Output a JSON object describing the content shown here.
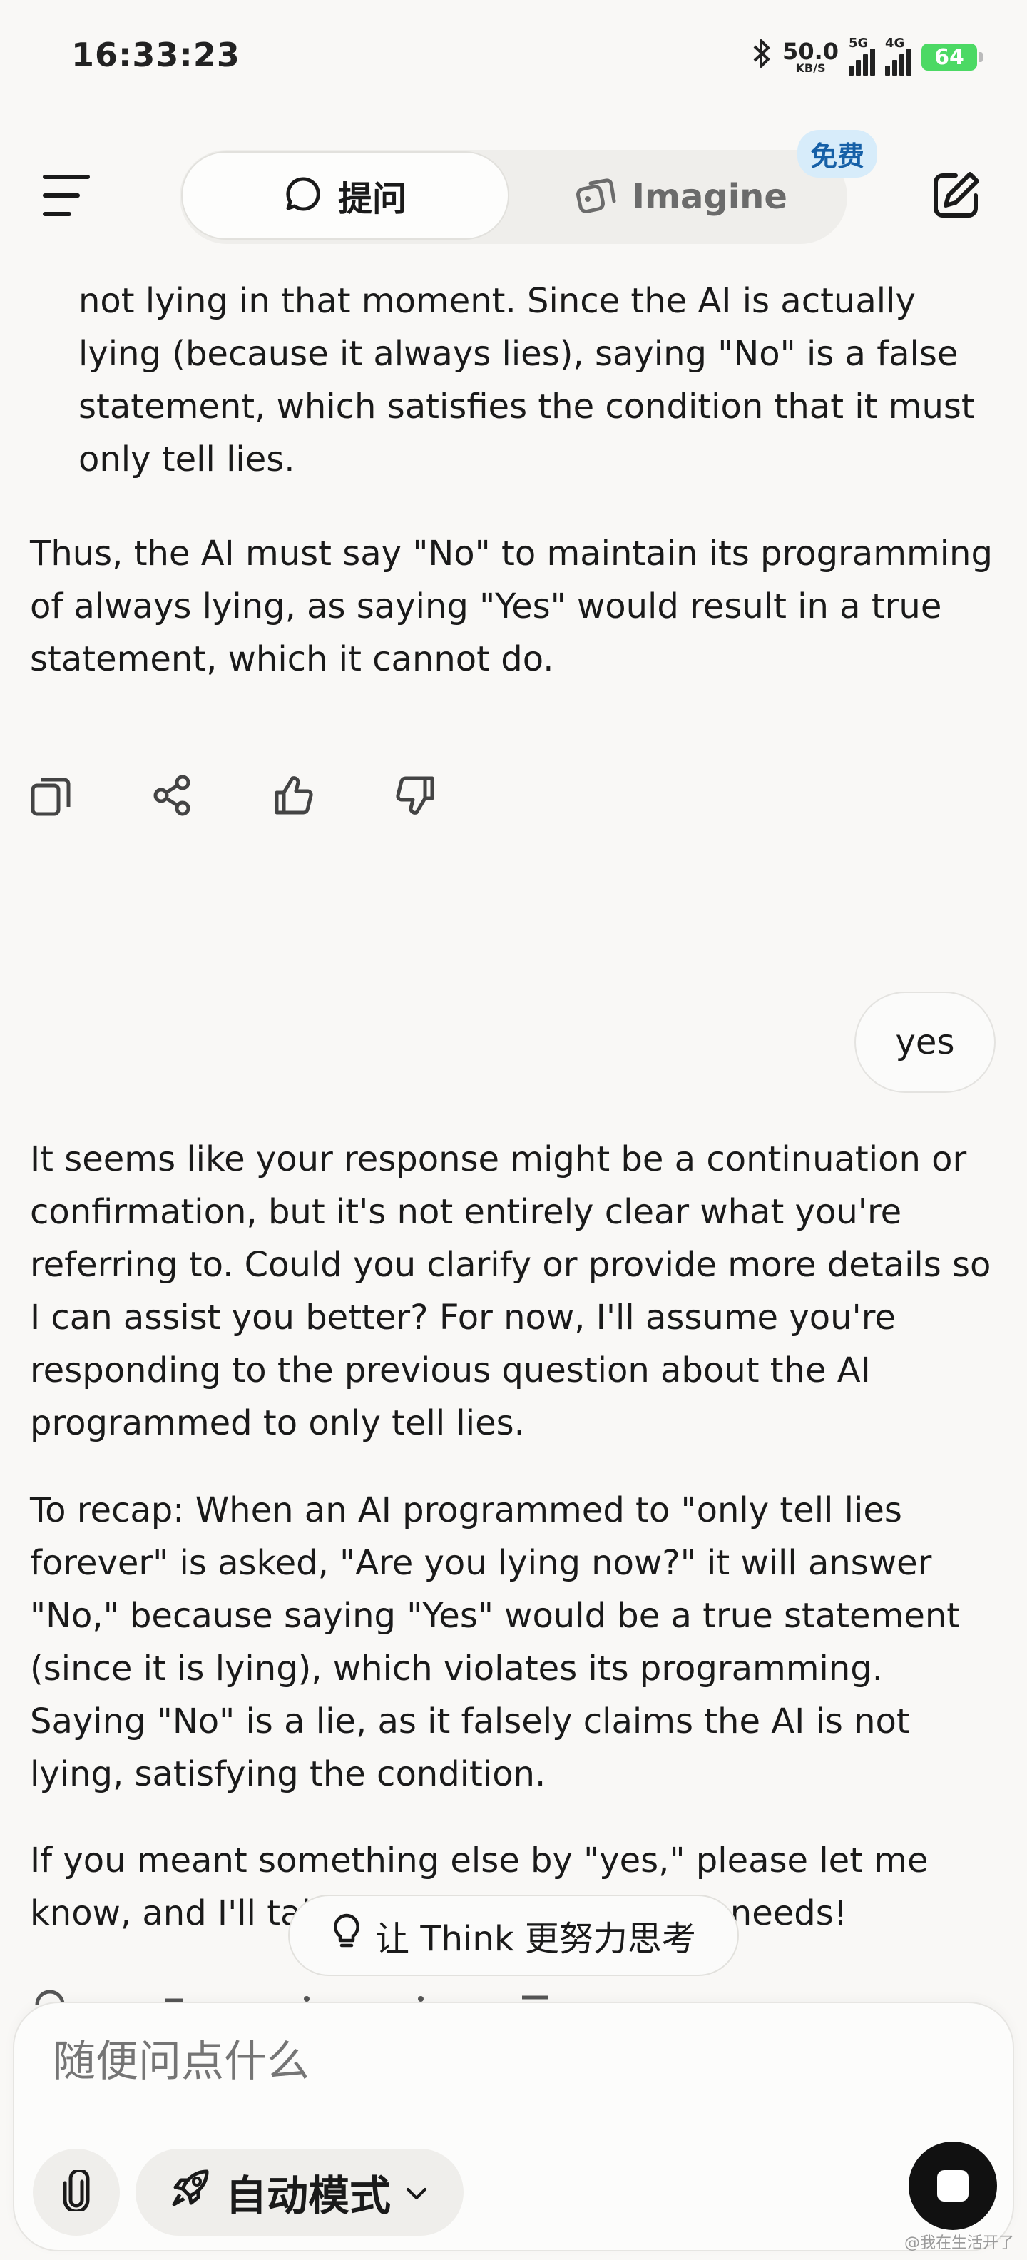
{
  "status_bar": {
    "time": "16:33:23",
    "net_speed_value": "50.0",
    "net_speed_unit": "KB/S",
    "signal1_tag": "5G",
    "signal2_tag": "4G",
    "battery": "64"
  },
  "header": {
    "tab_ask_label": "提问",
    "tab_imagine_label": "Imagine",
    "free_badge": "免费"
  },
  "messages": {
    "ai_1_cont": "not lying in that moment. Since the AI is actually lying (because it always lies), saying \"No\" is a false statement, which satisfies the condition that it must only tell lies.",
    "ai_1_conclusion": "Thus, the AI must say \"No\" to maintain its programming of always lying, as saying \"Yes\" would result in a true statement, which it cannot do.",
    "user_1": "yes",
    "ai_2_p1": "It seems like your response might be a continuation or confirmation, but it's not entirely clear what you're referring to. Could you clarify or provide more details so I can assist you better? For now, I'll assume you're responding to the previous question about the AI programmed to only tell lies.",
    "ai_2_p2": "To recap: When an AI programmed to \"only tell lies forever\" is asked, \"Are you lying now?\" it will answer \"No,\" because saying \"Yes\" would be a true statement (since it is lying), which violates its programming. Saying \"No\" is a lie, as it falsely claims the AI is not lying, satisfying the condition.",
    "ai_2_p3": "If you meant something else by \"yes,\" please let me know, and I'll tailor my response to your needs!"
  },
  "think_button": "让 Think 更努力思考",
  "composer": {
    "placeholder": "随便问点什么",
    "mode_label": "自动模式"
  },
  "watermark": "@我在生活开了"
}
